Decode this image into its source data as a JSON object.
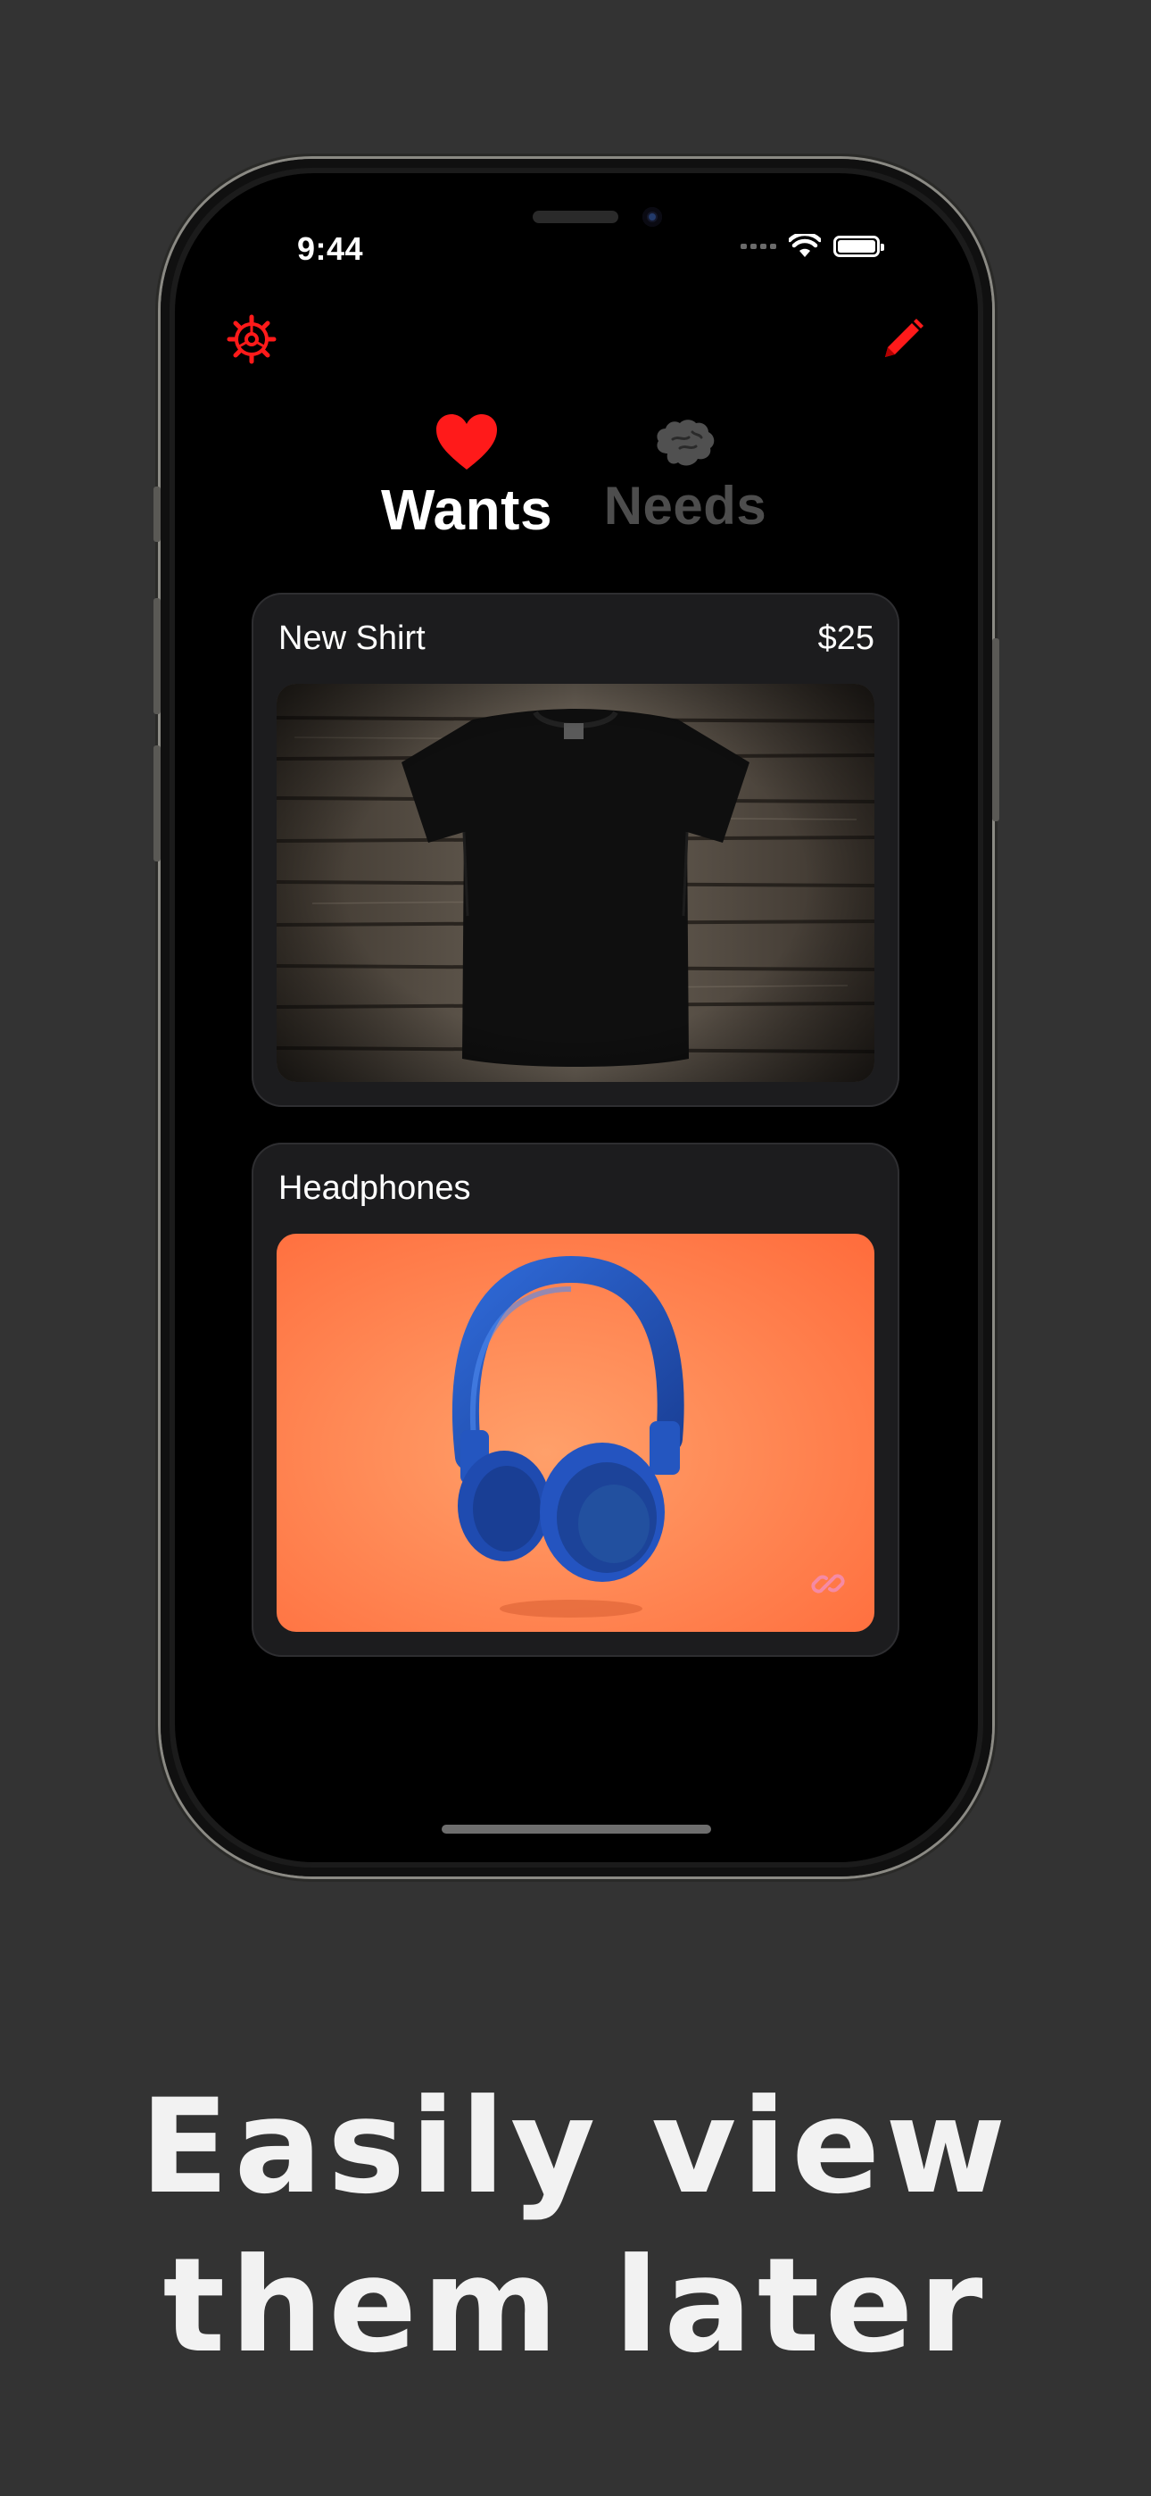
{
  "status_bar": {
    "time": "9:44"
  },
  "toolbar": {
    "settings_icon": "gear-icon",
    "edit_icon": "pencil-icon"
  },
  "tabs": [
    {
      "label": "Wants",
      "icon": "heart-icon",
      "selected": true
    },
    {
      "label": "Needs",
      "icon": "brain-icon",
      "selected": false
    }
  ],
  "items": [
    {
      "title": "New Shirt",
      "price": "$25",
      "image": "black t-shirt on wooden planks",
      "has_link": false
    },
    {
      "title": "Headphones",
      "price": "",
      "image": "blue headphones on orange background",
      "has_link": true
    }
  ],
  "caption": {
    "line1": "Easily view",
    "line2": "them later"
  },
  "colors": {
    "accent": "#ff0000",
    "background": "#333333",
    "card": "#1c1c1e",
    "inactive_tab": "#4d4d4d",
    "link": "#f58aa4"
  }
}
